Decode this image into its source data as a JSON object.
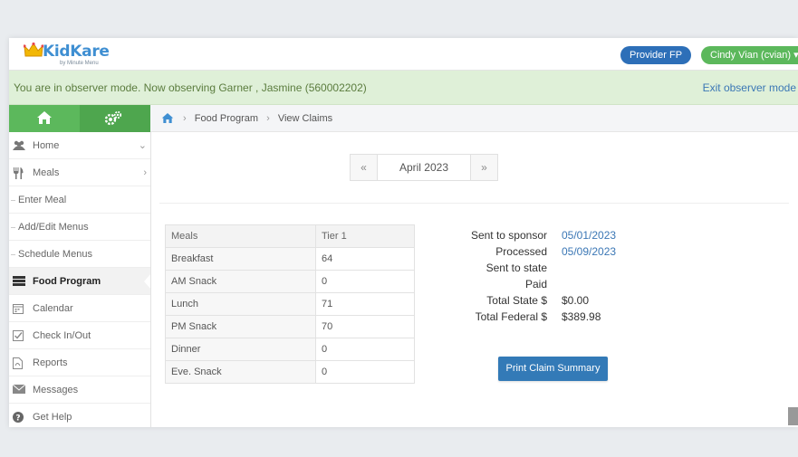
{
  "header": {
    "logo_text": "KidKare",
    "logo_subtext": "by Minute Menu",
    "provider_button": "Provider FP",
    "user_button": "Cindy Vian (cvian) ▾"
  },
  "observer_bar": {
    "message": "You are in observer mode. Now observing Garner , Jasmine (560002202)",
    "exit_link": "Exit observer mode"
  },
  "breadcrumb": [
    "Food Program",
    "View Claims"
  ],
  "sidebar": {
    "items": [
      {
        "label": "Home",
        "chevron": "⌄",
        "icon": "users-icon"
      },
      {
        "label": "Meals",
        "chevron": "›",
        "icon": "utensils-icon"
      },
      {
        "label": "Enter Meal"
      },
      {
        "label": "Add/Edit Menus"
      },
      {
        "label": "Schedule Menus"
      },
      {
        "label": "Food Program",
        "icon": "server-icon"
      },
      {
        "label": "Calendar",
        "icon": "calendar-icon"
      },
      {
        "label": "Check In/Out",
        "icon": "check-square-icon"
      },
      {
        "label": "Reports",
        "icon": "file-icon"
      },
      {
        "label": "Messages",
        "icon": "envelope-icon"
      },
      {
        "label": "Get Help",
        "icon": "question-circle-icon"
      }
    ]
  },
  "month_nav": {
    "prev": "«",
    "month": "April 2023",
    "next": "»"
  },
  "meals_table": {
    "headers": [
      "Meals",
      "Tier 1"
    ],
    "rows": [
      [
        "Breakfast",
        "64"
      ],
      [
        "AM Snack",
        "0"
      ],
      [
        "Lunch",
        "71"
      ],
      [
        "PM Snack",
        "70"
      ],
      [
        "Dinner",
        "0"
      ],
      [
        "Eve. Snack",
        "0"
      ]
    ]
  },
  "claim_summary": {
    "sent_to_sponsor_label": "Sent to sponsor",
    "sent_to_sponsor_value": "05/01/2023",
    "processed_label": "Processed",
    "processed_value": "05/09/2023",
    "sent_to_state_label": "Sent to state",
    "paid_label": "Paid",
    "total_state_label": "Total State $",
    "total_state_value": "$0.00",
    "total_federal_label": "Total Federal $",
    "total_federal_value": "$389.98",
    "print_button": "Print Claim Summary"
  },
  "colors": {
    "brand_blue": "#3f8fd2",
    "green": "#5cb85c",
    "observer_bg": "#dff0d8",
    "primary_button": "#337ab7"
  }
}
